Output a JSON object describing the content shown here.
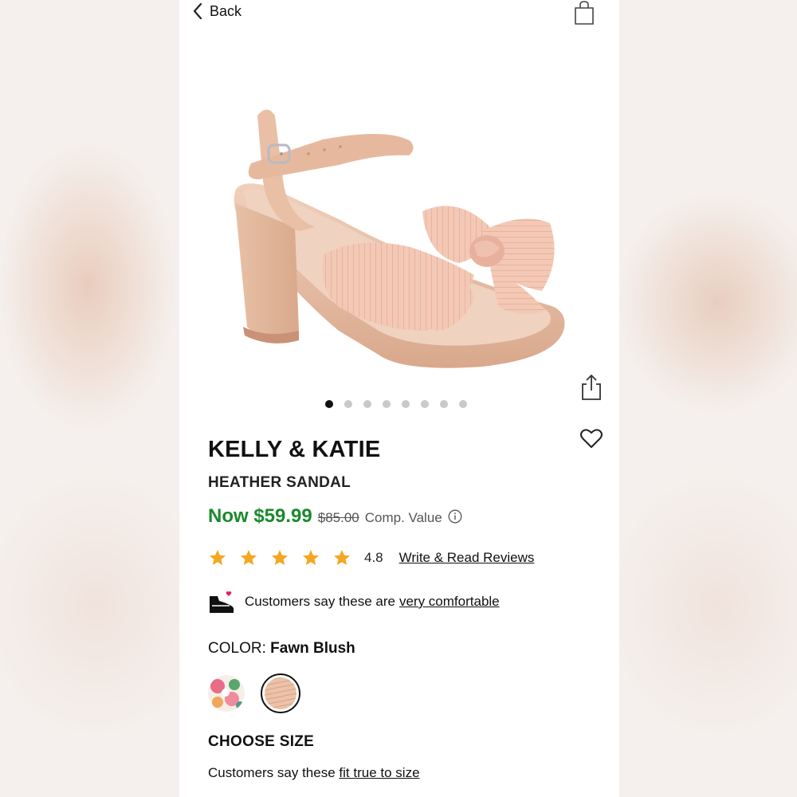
{
  "nav": {
    "back_label": "Back",
    "bag_icon": "shopping-bag-icon"
  },
  "gallery": {
    "image_count": 8,
    "active_index": 0
  },
  "product": {
    "brand": "KELLY & KATIE",
    "name": "HEATHER SANDAL",
    "now_price": "Now $59.99",
    "original_price": "$85.00",
    "comp_label": "Comp. Value"
  },
  "rating": {
    "stars": 5,
    "value": "4.8",
    "reviews_link": "Write & Read Reviews"
  },
  "comfort": {
    "prefix": "Customers say these are",
    "link": "very comfortable"
  },
  "color": {
    "label": "COLOR:",
    "selected": "Fawn Blush"
  },
  "size": {
    "heading": "CHOOSE SIZE",
    "fit_prefix": "Customers say these",
    "fit_link": "fit true to size"
  },
  "colors": {
    "price_green": "#1a8a2c",
    "star_orange": "#f5a623",
    "product_blush": "#e8bfa5"
  }
}
